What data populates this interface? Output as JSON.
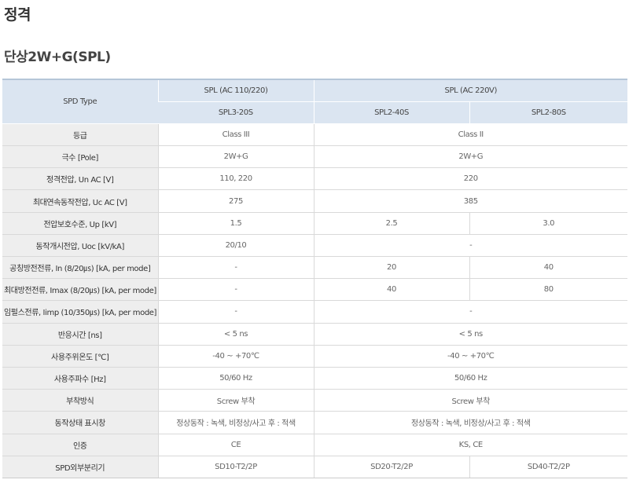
{
  "page": {
    "title": "정격",
    "section": "단상2W+G(SPL)"
  },
  "table": {
    "header": {
      "spd_type": "SPD Type",
      "group1": "SPL (AC 110/220)",
      "group2": "SPL (AC 220V)",
      "models": [
        "SPL3-20S",
        "SPL2-40S",
        "SPL2-80S"
      ]
    },
    "rows": [
      {
        "label": "등급",
        "values": [
          "Class III",
          "Class II"
        ]
      },
      {
        "label": "극수 [Pole]",
        "values": [
          "2W+G",
          "2W+G"
        ]
      },
      {
        "label": "정격전압, Un AC [V]",
        "values": [
          "110, 220",
          "220"
        ]
      },
      {
        "label": "최대연속동작전압, Uc AC [V]",
        "values": [
          "275",
          "385"
        ]
      },
      {
        "label": "전압보호수준, Up [kV]",
        "values": [
          "1.5",
          "2.5",
          "3.0"
        ]
      },
      {
        "label": "동작개시전압, Uoc [kV/kA]",
        "values": [
          "20/10",
          "-"
        ]
      },
      {
        "label": "공칭방전전류, In (8/20㎲) [kA, per mode]",
        "values": [
          "-",
          "20",
          "40"
        ]
      },
      {
        "label": "최대방전전류, Imax (8/20㎲) [kA, per mode]",
        "values": [
          "-",
          "40",
          "80"
        ]
      },
      {
        "label": "임펄스전류, Iimp (10/350㎲) [kA, per mode]",
        "values": [
          "-",
          "-"
        ]
      },
      {
        "label": "반응시간 [ns]",
        "values": [
          "< 5 ns",
          "< 5 ns"
        ]
      },
      {
        "label": "사용주위온도 [℃]",
        "values": [
          "-40 ~ +70℃",
          "-40 ~ +70℃"
        ]
      },
      {
        "label": "사용주파수 [Hz]",
        "values": [
          "50/60 Hz",
          "50/60 Hz"
        ]
      },
      {
        "label": "부착방식",
        "values": [
          "Screw 부착",
          "Screw 부착"
        ]
      },
      {
        "label": "동작상태 표시창",
        "values": [
          "정상동작 : 녹색, 비정상/사고 후 : 적색",
          "정상동작 : 녹색, 비정상/사고 후 : 적색"
        ]
      },
      {
        "label": "인증",
        "values": [
          "CE",
          "KS, CE"
        ]
      },
      {
        "label": "SPD외부분리기",
        "values": [
          "SD10-T2/2P",
          "SD20-T2/2P",
          "SD40-T2/2P"
        ]
      }
    ]
  }
}
